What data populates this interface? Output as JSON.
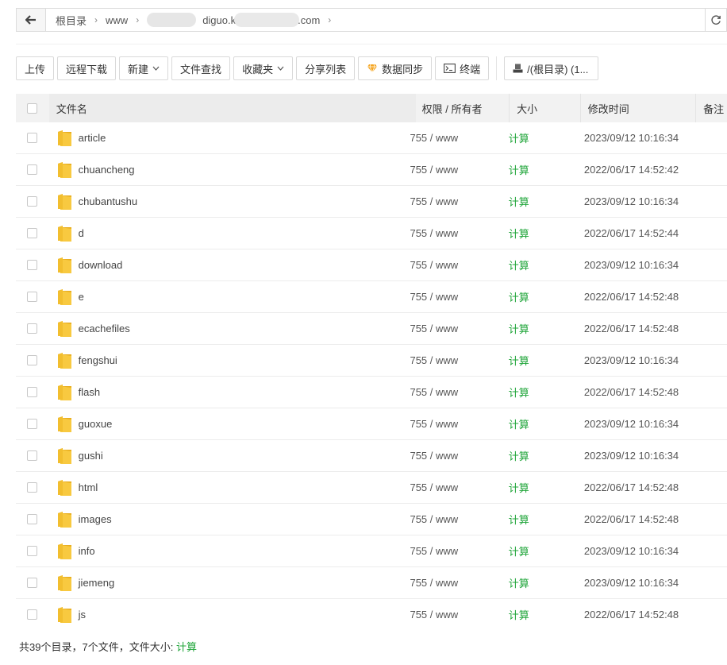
{
  "breadcrumb": {
    "items": [
      "根目录",
      "www",
      "diguo.k",
      ".com"
    ]
  },
  "toolbar": {
    "upload": "上传",
    "remote_download": "远程下载",
    "new": "新建",
    "file_search": "文件查找",
    "favorites": "收藏夹",
    "share_list": "分享列表",
    "data_sync": "数据同步",
    "terminal": "终端",
    "disk": "/(根目录) (1..."
  },
  "columns": {
    "name": "文件名",
    "perm": "权限 / 所有者",
    "size": "大小",
    "mtime": "修改时间",
    "note": "备注"
  },
  "rows": [
    {
      "name": "article",
      "perm": "755 / www",
      "size": "计算",
      "mtime": "2023/09/12 10:16:34"
    },
    {
      "name": "chuancheng",
      "perm": "755 / www",
      "size": "计算",
      "mtime": "2022/06/17 14:52:42"
    },
    {
      "name": "chubantushu",
      "perm": "755 / www",
      "size": "计算",
      "mtime": "2023/09/12 10:16:34"
    },
    {
      "name": "d",
      "perm": "755 / www",
      "size": "计算",
      "mtime": "2022/06/17 14:52:44"
    },
    {
      "name": "download",
      "perm": "755 / www",
      "size": "计算",
      "mtime": "2023/09/12 10:16:34"
    },
    {
      "name": "e",
      "perm": "755 / www",
      "size": "计算",
      "mtime": "2022/06/17 14:52:48"
    },
    {
      "name": "ecachefiles",
      "perm": "755 / www",
      "size": "计算",
      "mtime": "2022/06/17 14:52:48"
    },
    {
      "name": "fengshui",
      "perm": "755 / www",
      "size": "计算",
      "mtime": "2023/09/12 10:16:34"
    },
    {
      "name": "flash",
      "perm": "755 / www",
      "size": "计算",
      "mtime": "2022/06/17 14:52:48"
    },
    {
      "name": "guoxue",
      "perm": "755 / www",
      "size": "计算",
      "mtime": "2023/09/12 10:16:34"
    },
    {
      "name": "gushi",
      "perm": "755 / www",
      "size": "计算",
      "mtime": "2023/09/12 10:16:34"
    },
    {
      "name": "html",
      "perm": "755 / www",
      "size": "计算",
      "mtime": "2022/06/17 14:52:48"
    },
    {
      "name": "images",
      "perm": "755 / www",
      "size": "计算",
      "mtime": "2022/06/17 14:52:48"
    },
    {
      "name": "info",
      "perm": "755 / www",
      "size": "计算",
      "mtime": "2023/09/12 10:16:34"
    },
    {
      "name": "jiemeng",
      "perm": "755 / www",
      "size": "计算",
      "mtime": "2023/09/12 10:16:34"
    },
    {
      "name": "js",
      "perm": "755 / www",
      "size": "计算",
      "mtime": "2022/06/17 14:52:48"
    }
  ],
  "footer": {
    "summary": "共39个目录，7个文件，文件大小:",
    "calc": "计算"
  },
  "colors": {
    "accent_green": "#20a53a",
    "folder_yellow": "#f5c33b"
  },
  "icons": {
    "back": "arrow-left-icon",
    "refresh": "refresh-icon",
    "folder": "folder-icon",
    "data_sync": "diamond-icon",
    "terminal": "terminal-icon",
    "disk": "disk-icon",
    "dropdown": "caret-down-icon",
    "separator": "chevron-right-icon"
  }
}
